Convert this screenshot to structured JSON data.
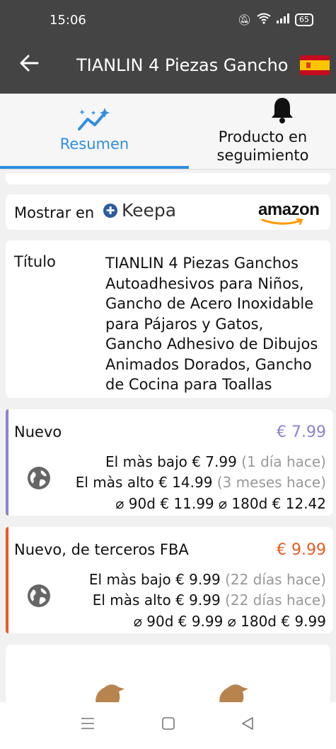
{
  "status": {
    "time": "15:06",
    "battery": "65"
  },
  "appbar": {
    "title": "TIANLIN 4 Piezas Gancho",
    "back_icon": "arrow-left-icon",
    "flag_icon": "spain-flag-icon"
  },
  "tabs": [
    {
      "label": "Resumen",
      "icon": "sparkle-chart-icon",
      "active": true
    },
    {
      "label": "Producto en seguimiento",
      "icon": "bell-icon",
      "active": false
    }
  ],
  "show_in": {
    "label": "Mostrar en",
    "keepa": "Keepa",
    "amazon": "amazon"
  },
  "title_row": {
    "label": "Título",
    "value": "TIANLIN 4 Piezas Ganchos Autoadhesivos para Niños, Gancho de Acero Inoxidable para Pájaros y Gatos, Gancho Adhesivo de Dibujos Animados Dorados, Gancho de Cocina para Toallas"
  },
  "prices": [
    {
      "name": "Nuevo",
      "current": "€ 7.99",
      "color": "#8b83d3",
      "lowest_label": "El màs bajo",
      "lowest": "€ 7.99",
      "lowest_when": "(1 día hace)",
      "highest_label": "El màs alto",
      "highest": "€ 14.99",
      "highest_when": "(3 meses hace)",
      "avg90_label": "⌀ 90d",
      "avg90": "€ 11.99",
      "avg180_label": "⌀ 180d",
      "avg180": "€ 12.42"
    },
    {
      "name": "Nuevo, de terceros FBA",
      "current": "€ 9.99",
      "color": "#e65a24",
      "lowest_label": "El màs bajo",
      "lowest": "€ 9.99",
      "lowest_when": "(22 días hace)",
      "highest_label": "El màs alto",
      "highest": "€ 9.99",
      "highest_when": "(22 días hace)",
      "avg90_label": "⌀ 90d",
      "avg90": "€ 9.99",
      "avg180_label": "⌀ 180d",
      "avg180": "€ 9.99"
    }
  ],
  "navbar": {
    "menu_icon": "menu-icon",
    "home_icon": "home-square-icon",
    "back_icon": "triangle-back-icon"
  }
}
